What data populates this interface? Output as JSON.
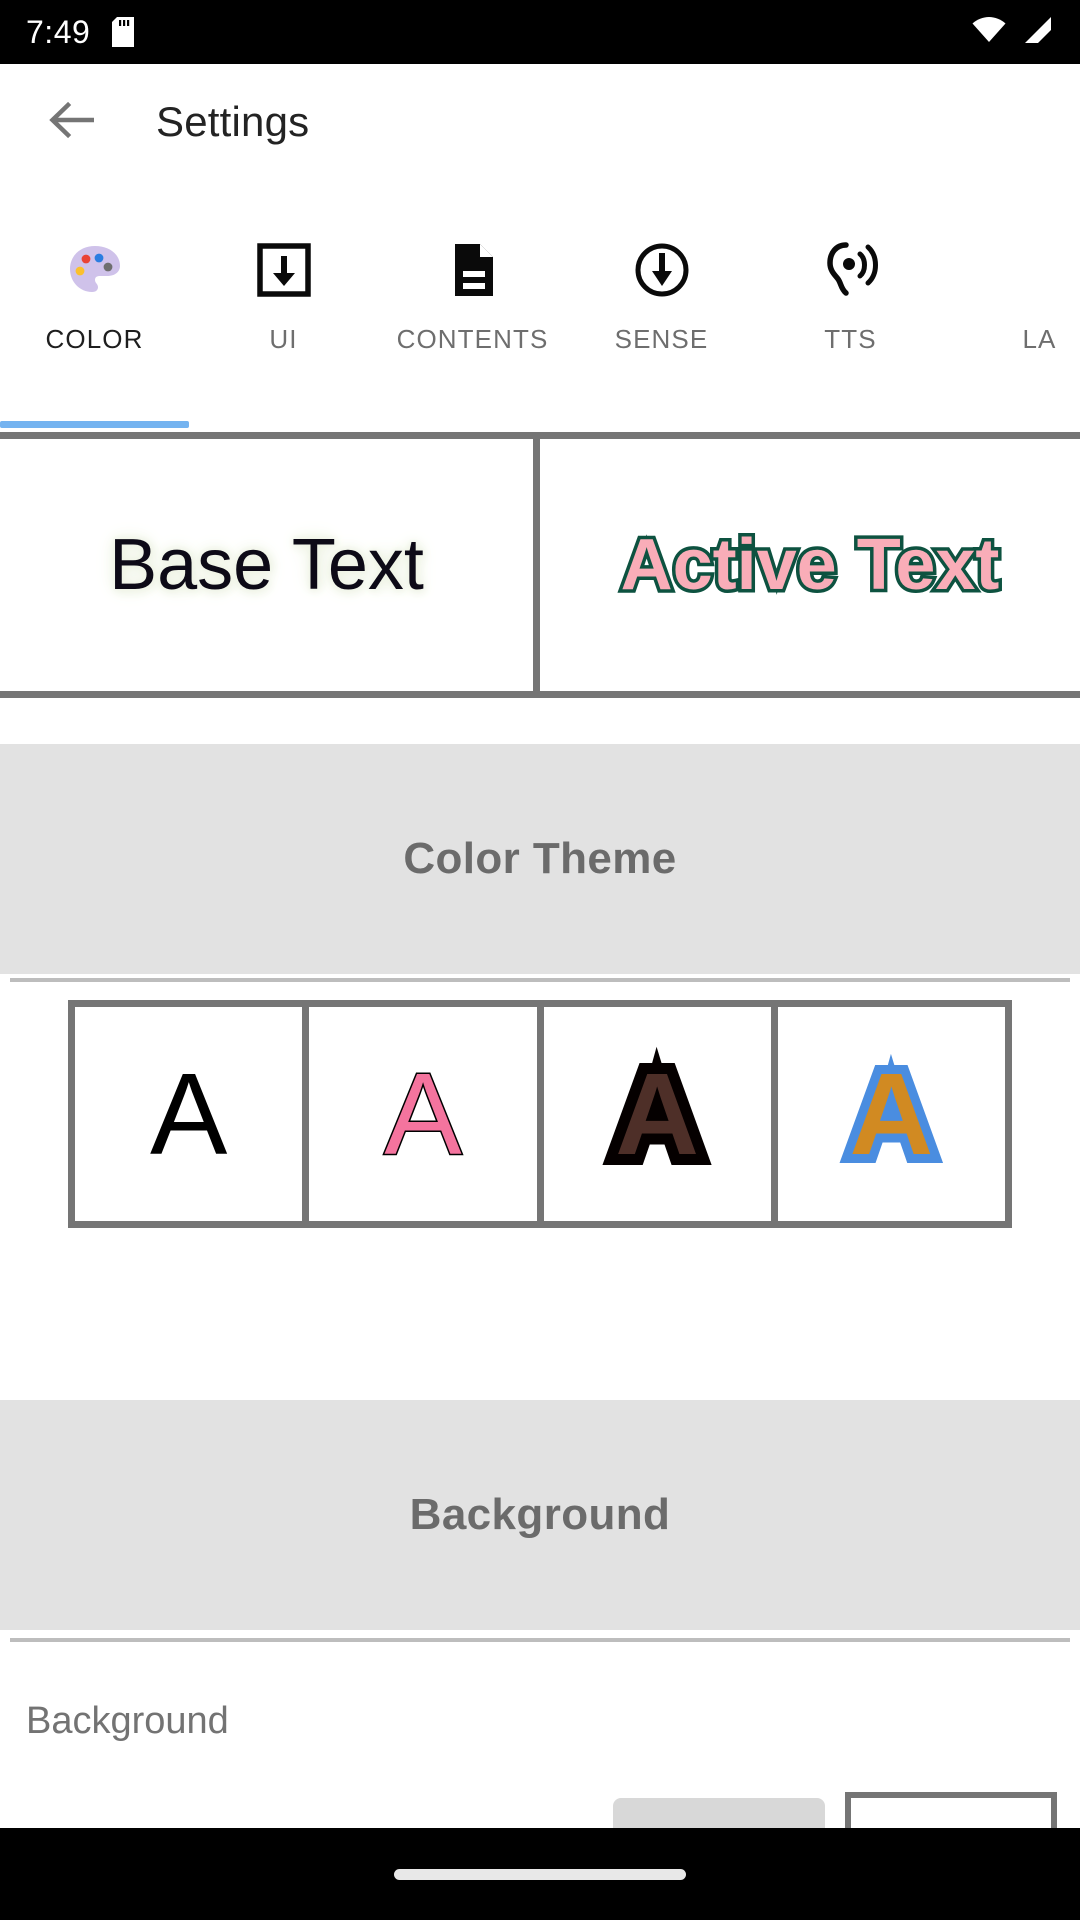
{
  "status_bar": {
    "time": "7:49",
    "sd_icon": "sd-card-icon",
    "wifi_icon": "wifi-icon",
    "signal_icon": "cellular-signal-icon"
  },
  "app_bar": {
    "back_icon": "back-arrow-icon",
    "title": "Settings"
  },
  "tabs": [
    {
      "label": "COLOR",
      "icon": "color-palette-icon",
      "active": true
    },
    {
      "label": "UI",
      "icon": "download-box-icon",
      "active": false
    },
    {
      "label": "CONTENTS",
      "icon": "document-icon",
      "active": false
    },
    {
      "label": "SENSE",
      "icon": "circle-down-arrow-icon",
      "active": false
    },
    {
      "label": "TTS",
      "icon": "hearing-icon",
      "active": false
    },
    {
      "label": "LA",
      "icon": "language-icon",
      "active": false
    }
  ],
  "preview": {
    "base_text": "Base Text",
    "base_text_color": "#0d0a17",
    "base_glow_color": "#eef3e4",
    "active_text": "Active Text",
    "active_fill_color": "#f9adb8",
    "active_stroke_color": "#0d5240"
  },
  "sections": {
    "color_theme": "Color Theme",
    "background": "Background"
  },
  "color_theme_swatches": [
    {
      "glyph": "A",
      "name": "theme-plain-black",
      "fill": "#000000",
      "stroke": "none"
    },
    {
      "glyph": "A",
      "name": "theme-pink",
      "fill": "#f4749e",
      "stroke": "#000000"
    },
    {
      "glyph": "A",
      "name": "theme-brown-black",
      "fill": "#4e2f28",
      "stroke": "#050000"
    },
    {
      "glyph": "A",
      "name": "theme-orange-blue",
      "fill": "#d18a22",
      "stroke": "#4a8de0"
    }
  ],
  "background_row": {
    "label": "Background",
    "swatch_gray": "#d8d8d8",
    "swatch_white": "#ffffff"
  },
  "nav_bar": {
    "gesture_pill": "home-gesture-pill"
  },
  "theme_colors": {
    "accent_blue": "#74b3f0",
    "section_bg": "#e2e2e2",
    "border_gray": "#757575",
    "muted_text": "#6b6b6b"
  }
}
